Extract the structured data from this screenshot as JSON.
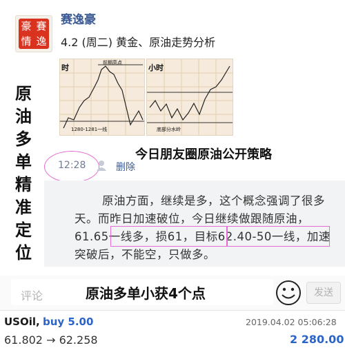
{
  "post": {
    "avatar_chars": [
      "豪",
      "賽",
      "情",
      "逸"
    ],
    "author": "赛逸豪",
    "title": "4.2 (周二) 黄金、原油走势分析",
    "chart_left_label_top": "时",
    "chart_left_label_line": "1280-1281一线",
    "chart_left_label_peak": "前期高点",
    "chart_right_label_top": "小时",
    "chart_right_label_bottom": "底部分水岭",
    "time": "12:28",
    "delete_label": "删除",
    "comment": "原油方面，继续是多，这个概念强调了很多天。而昨日加速破位，今日继续做跟随原油，61.65一线多，损61，目标62.40-50一线，加速突破后，不能空，只做多。"
  },
  "overlay": {
    "vertical_text": [
      "原",
      "油",
      "多",
      "单",
      "精",
      "准",
      "定",
      "位"
    ],
    "strategy": "今日朋友圈原油公开策略",
    "caption": "原油多单小获4个点"
  },
  "input": {
    "placeholder": "评论",
    "send_label": "发送",
    "emoji_icon": "smile-icon"
  },
  "trade": {
    "symbol": "USOil,",
    "side": "buy 5.00",
    "datetime": "2019.04.02 05:06:28",
    "prices": "61.802 → 62.258",
    "profit": "2 280.00"
  },
  "colors": {
    "link": "#3c5b95",
    "highlight": "#e46bd1",
    "buy": "#2a63c9",
    "seal": "#d9321f"
  }
}
